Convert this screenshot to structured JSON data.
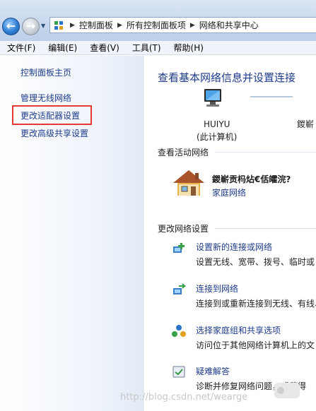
{
  "breadcrumb": {
    "items": [
      "控制面板",
      "所有控制面板项",
      "网络和共享中心"
    ]
  },
  "menu": [
    "文件(F)",
    "编辑(E)",
    "查看(V)",
    "工具(T)",
    "帮助(H)"
  ],
  "sidebar": {
    "home": "控制面板主页",
    "links": [
      "管理无线网络",
      "更改适配器设置",
      "更改高级共享设置"
    ]
  },
  "main": {
    "title": "查看基本网络信息并设置连接",
    "computer_name": "HUIYU",
    "computer_sub": "(此计算机)",
    "net_right_label": "鍐嶄",
    "active_header": "查看活动网络",
    "network_name": "鍐嶄贡杩炶€佸皬浣?",
    "network_type": "家庭网络",
    "change_header": "更改网络设置",
    "tasks": [
      {
        "icon": "network-setup-icon",
        "link": "设置新的连接或网络",
        "desc": "设置无线、宽带、拨号、临时或"
      },
      {
        "icon": "network-connect-icon",
        "link": "连接到网络",
        "desc": "连接到或重新连接到无线、有线、"
      },
      {
        "icon": "homegroup-icon",
        "link": "选择家庭组和共享选项",
        "desc": "访问位于其他网络计算机上的文"
      },
      {
        "icon": "troubleshoot-icon",
        "link": "疑难解答",
        "desc": "诊断并修复网络问题，或获得"
      }
    ]
  },
  "watermark": "http://blog.csdn.net/wearge",
  "colors": {
    "link": "#1e3c8c",
    "highlight_box": "#e53935",
    "sidebar_bg": "#eef3fb"
  }
}
